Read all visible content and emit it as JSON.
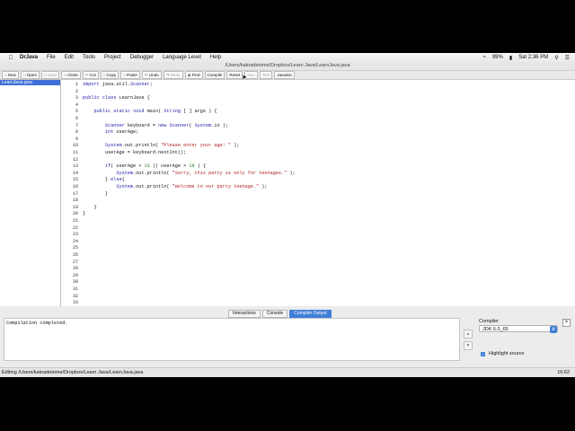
{
  "menu": {
    "app": "DrJava",
    "items": [
      "File",
      "Edit",
      "Tools",
      "Project",
      "Debugger",
      "Language Level",
      "Help"
    ],
    "battery": "99%",
    "clock": "Sat 2:36 PM"
  },
  "window": {
    "title": "/Users/kakradetome/Dropbox/Learn Java/LearnJava.java"
  },
  "toolbar": {
    "new": "New",
    "open": "Open",
    "save": "Save",
    "close": "Close",
    "cut": "Cut",
    "copy": "Copy",
    "paste": "Paste",
    "undo": "Undo",
    "redo": "Redo",
    "find": "Find",
    "compile": "Compile",
    "reset": "Reset",
    "run": "Run",
    "test": "Test",
    "javadoc": "Javadoc"
  },
  "files": [
    "LearnJava.java"
  ],
  "code_lines": [
    "import java.util.Scanner;",
    "",
    "public class LearnJava {",
    "",
    "    public static void main( String [ ] args ) {",
    "",
    "        Scanner keyboard = new Scanner( System.in );",
    "        int userAge;",
    "",
    "        System.out.println( \"Please enter your age: \" );",
    "        userAge = keyboard.nextInt();",
    "",
    "        if( userAge < 13 || userAge > 19 ) {",
    "            System.out.println( \"Sorry, this party is only for teenages.\" );",
    "        } else{",
    "            System.out.println( \"Welcome to our party teenage.\" );",
    "        }",
    "",
    "    }",
    "}",
    "",
    "",
    "",
    "",
    "",
    "",
    "",
    "",
    "",
    "",
    "",
    "",
    ""
  ],
  "tabs": [
    "Interactions",
    "Console",
    "Compiler Output"
  ],
  "active_tab": "Compiler Output",
  "output": "Compilation completed.",
  "compiler": {
    "label": "Compiler",
    "selected": "JDK 6.0_65",
    "highlight_label": "Highlight source",
    "highlight_checked": true
  },
  "status": {
    "left": "Editing /Users/kakradetome/Dropbox/Learn Java/LearnJava.java",
    "right": "16:62"
  },
  "colors": {
    "accent": "#3f7fd8",
    "selection": "#3f6fd6"
  }
}
